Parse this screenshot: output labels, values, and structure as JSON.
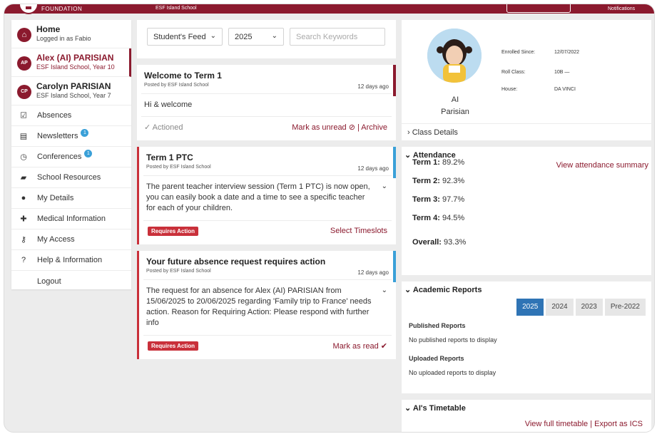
{
  "topbar": {
    "brand": "FOUNDATION",
    "school": "ESF Island School",
    "notifications": "Notifications"
  },
  "sidebar": {
    "home": {
      "title": "Home",
      "subtitle": "Logged in as Fabio"
    },
    "children": [
      {
        "initials": "AP",
        "name": "Alex (AI) PARISIAN",
        "detail": "ESF Island School, Year 10"
      },
      {
        "initials": "CP",
        "name": "Carolyn PARISIAN",
        "detail": "ESF Island School, Year 7"
      }
    ],
    "items": [
      {
        "label": "Absences",
        "icon": "absence-icon",
        "badge": ""
      },
      {
        "label": "Newsletters",
        "icon": "newsletter-icon",
        "badge": "1"
      },
      {
        "label": "Conferences",
        "icon": "clock-icon",
        "badge": "1"
      },
      {
        "label": "School Resources",
        "icon": "folder-icon",
        "badge": ""
      },
      {
        "label": "My Details",
        "icon": "person-icon",
        "badge": ""
      },
      {
        "label": "Medical Information",
        "icon": "medical-icon",
        "badge": ""
      },
      {
        "label": "My Access",
        "icon": "key-icon",
        "badge": ""
      },
      {
        "label": "Help & Information",
        "icon": "help-icon",
        "badge": ""
      }
    ],
    "logout": "Logout"
  },
  "filters": {
    "feed_select": "Student's Feed",
    "year_select": "2025",
    "search_placeholder": "Search Keywords"
  },
  "feed": [
    {
      "title": "Welcome to Term 1",
      "posted": "Posted by ESF Island School",
      "age": "12 days ago",
      "body": "Hi & welcome",
      "status": "Actioned",
      "actions": "Mark as unread ⊘ | Archive"
    },
    {
      "title": "Term 1 PTC",
      "posted": "Posted by ESF Island School",
      "age": "12 days ago",
      "body": "The parent teacher interview session (Term 1 PTC) is now open, you can easily book a date and a time to see a specific teacher for each of your children.",
      "badge": "Requires Action",
      "action": "Select Timeslots"
    },
    {
      "title": "Your future absence request requires action",
      "posted": "Posted by ESF Island School",
      "age": "12 days ago",
      "body": "The request for an absence for Alex (AI) PARISIAN from 15/06/2025 to 20/06/2025 regarding 'Family trip to France' needs action. Reason for Requiring Action: Please respond with further info",
      "badge": "Requires Action",
      "action": "Mark as read ✔"
    }
  ],
  "profile": {
    "first_name": "AI",
    "last_name": "Parisian",
    "enrolled_label": "Enrolled Since:",
    "enrolled_value": "12/07/2022",
    "roll_label": "Roll Class:",
    "roll_value": "10B —",
    "house_label": "House:",
    "house_value": "DA VINCI",
    "class_details": "Class Details"
  },
  "attendance": {
    "heading": "Attendance",
    "link": "View attendance summary",
    "terms": [
      {
        "label": "Term 1:",
        "value": "89.2%"
      },
      {
        "label": "Term 2:",
        "value": "92.3%"
      },
      {
        "label": "Term 3:",
        "value": "97.7%"
      },
      {
        "label": "Term 4:",
        "value": "94.5%"
      }
    ],
    "overall_label": "Overall:",
    "overall_value": "93.3%"
  },
  "reports": {
    "heading": "Academic Reports",
    "years": [
      "2025",
      "2024",
      "2023",
      "Pre-2022"
    ],
    "published_label": "Published Reports",
    "published_text": "No published reports to display",
    "uploaded_label": "Uploaded Reports",
    "uploaded_text": "No uploaded reports to display"
  },
  "timetable": {
    "heading": "AI's Timetable",
    "view_link": "View full timetable",
    "export_link": "Export as ICS"
  },
  "colors": {
    "brand": "#8b1a2e",
    "action_red": "#c9303a",
    "info_blue": "#3aa0d8",
    "active_tab": "#2f74b5"
  }
}
